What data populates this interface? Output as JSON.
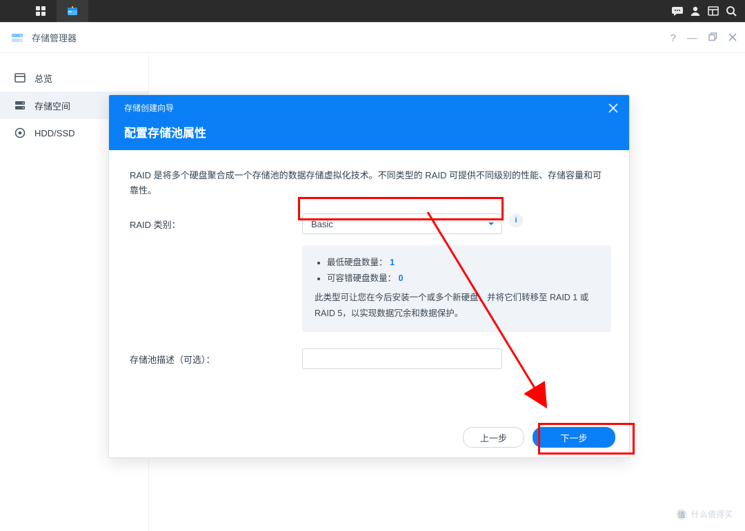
{
  "topbar": {
    "left_icons": [
      "grid-apps-icon",
      "package-icon"
    ],
    "right_icons": [
      "chat-bubble-icon",
      "user-icon",
      "window-panels-icon",
      "search-icon"
    ]
  },
  "app": {
    "title": "存储管理器",
    "window_controls": [
      "help",
      "minimize",
      "restore",
      "close"
    ]
  },
  "sidebar": {
    "items": [
      {
        "icon": "overview-icon",
        "label": "总览",
        "active": false
      },
      {
        "icon": "storage-icon",
        "label": "存储空间",
        "active": true
      },
      {
        "icon": "disk-icon",
        "label": "HDD/SSD",
        "active": false
      }
    ]
  },
  "modal": {
    "wizard_title": "存储创建向导",
    "section_title": "配置存储池属性",
    "description": "RAID 是将多个硬盘聚合成一个存储池的数据存储虚拟化技术。不同类型的 RAID 可提供不同级别的性能、存储容量和可靠性。",
    "raid_label": "RAID 类别：",
    "raid_value": "Basic",
    "info": {
      "min_disks_label": "最低硬盘数量：",
      "min_disks_value": "1",
      "fault_label": "可容错硬盘数量：",
      "fault_value": "0",
      "note": "此类型可让您在今后安装一个或多个新硬盘，并将它们转移至 RAID 1 或 RAID 5，以实现数据冗余和数据保护。"
    },
    "desc_label": "存储池描述（可选）：",
    "desc_value": "",
    "buttons": {
      "back": "上一步",
      "next": "下一步"
    }
  },
  "annotation": {
    "highlight_select": true,
    "highlight_next": true,
    "arrow": true
  },
  "watermark": "什么值得买"
}
